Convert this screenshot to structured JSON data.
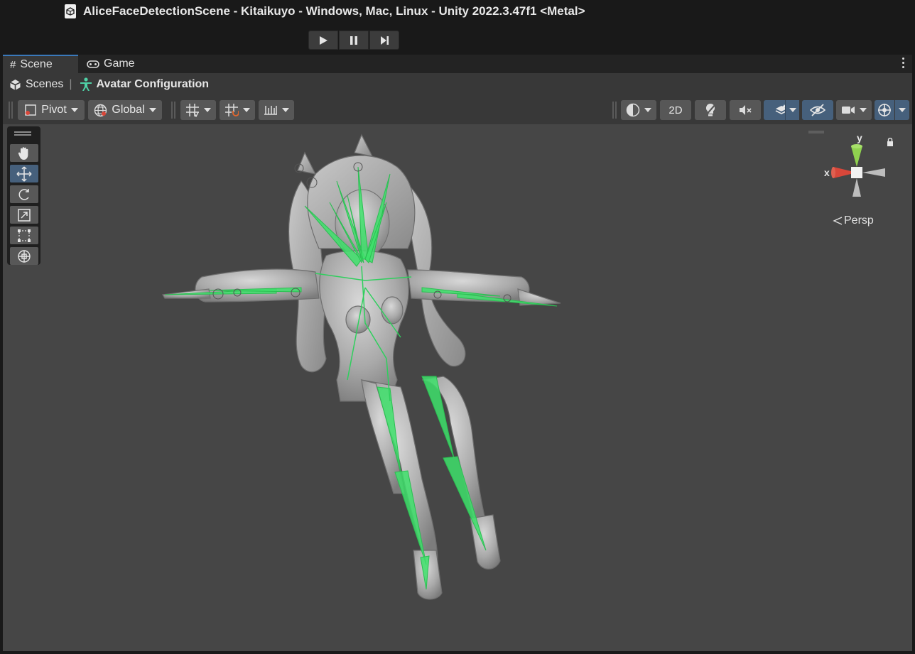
{
  "window": {
    "title": "AliceFaceDetectionScene - Kitaikuyo - Windows, Mac, Linux - Unity 2022.3.47f1 <Metal>"
  },
  "playbar": {
    "buttons": [
      "play-icon",
      "pause-icon",
      "step-icon"
    ]
  },
  "tabs": [
    {
      "label": "Scene",
      "icon": "hash-icon",
      "active": true
    },
    {
      "label": "Game",
      "icon": "gamepad-icon",
      "active": false
    }
  ],
  "breadcrumb": {
    "items": [
      {
        "label": "Scenes",
        "icon": "unity-cube-icon"
      },
      {
        "label": "Avatar Configuration",
        "icon": "humanoid-icon"
      }
    ]
  },
  "toolbar": {
    "pivot_label": "Pivot",
    "global_label": "Global",
    "mode_2d_label": "2D"
  },
  "tools": {
    "items": [
      "hand-tool-icon",
      "move-tool-icon",
      "rotate-tool-icon",
      "scale-tool-icon",
      "rect-tool-icon",
      "transform-tool-icon"
    ],
    "active": "move-tool-icon"
  },
  "gizmo": {
    "y_label": "y",
    "x_label": "x",
    "projection_label": "Persp"
  },
  "colors": {
    "viewport_bg": "#464646",
    "accent_blue": "#46607c",
    "bone_green": "#3ee06b",
    "axis_y": "#8fd14f",
    "axis_x": "#d9473a"
  }
}
